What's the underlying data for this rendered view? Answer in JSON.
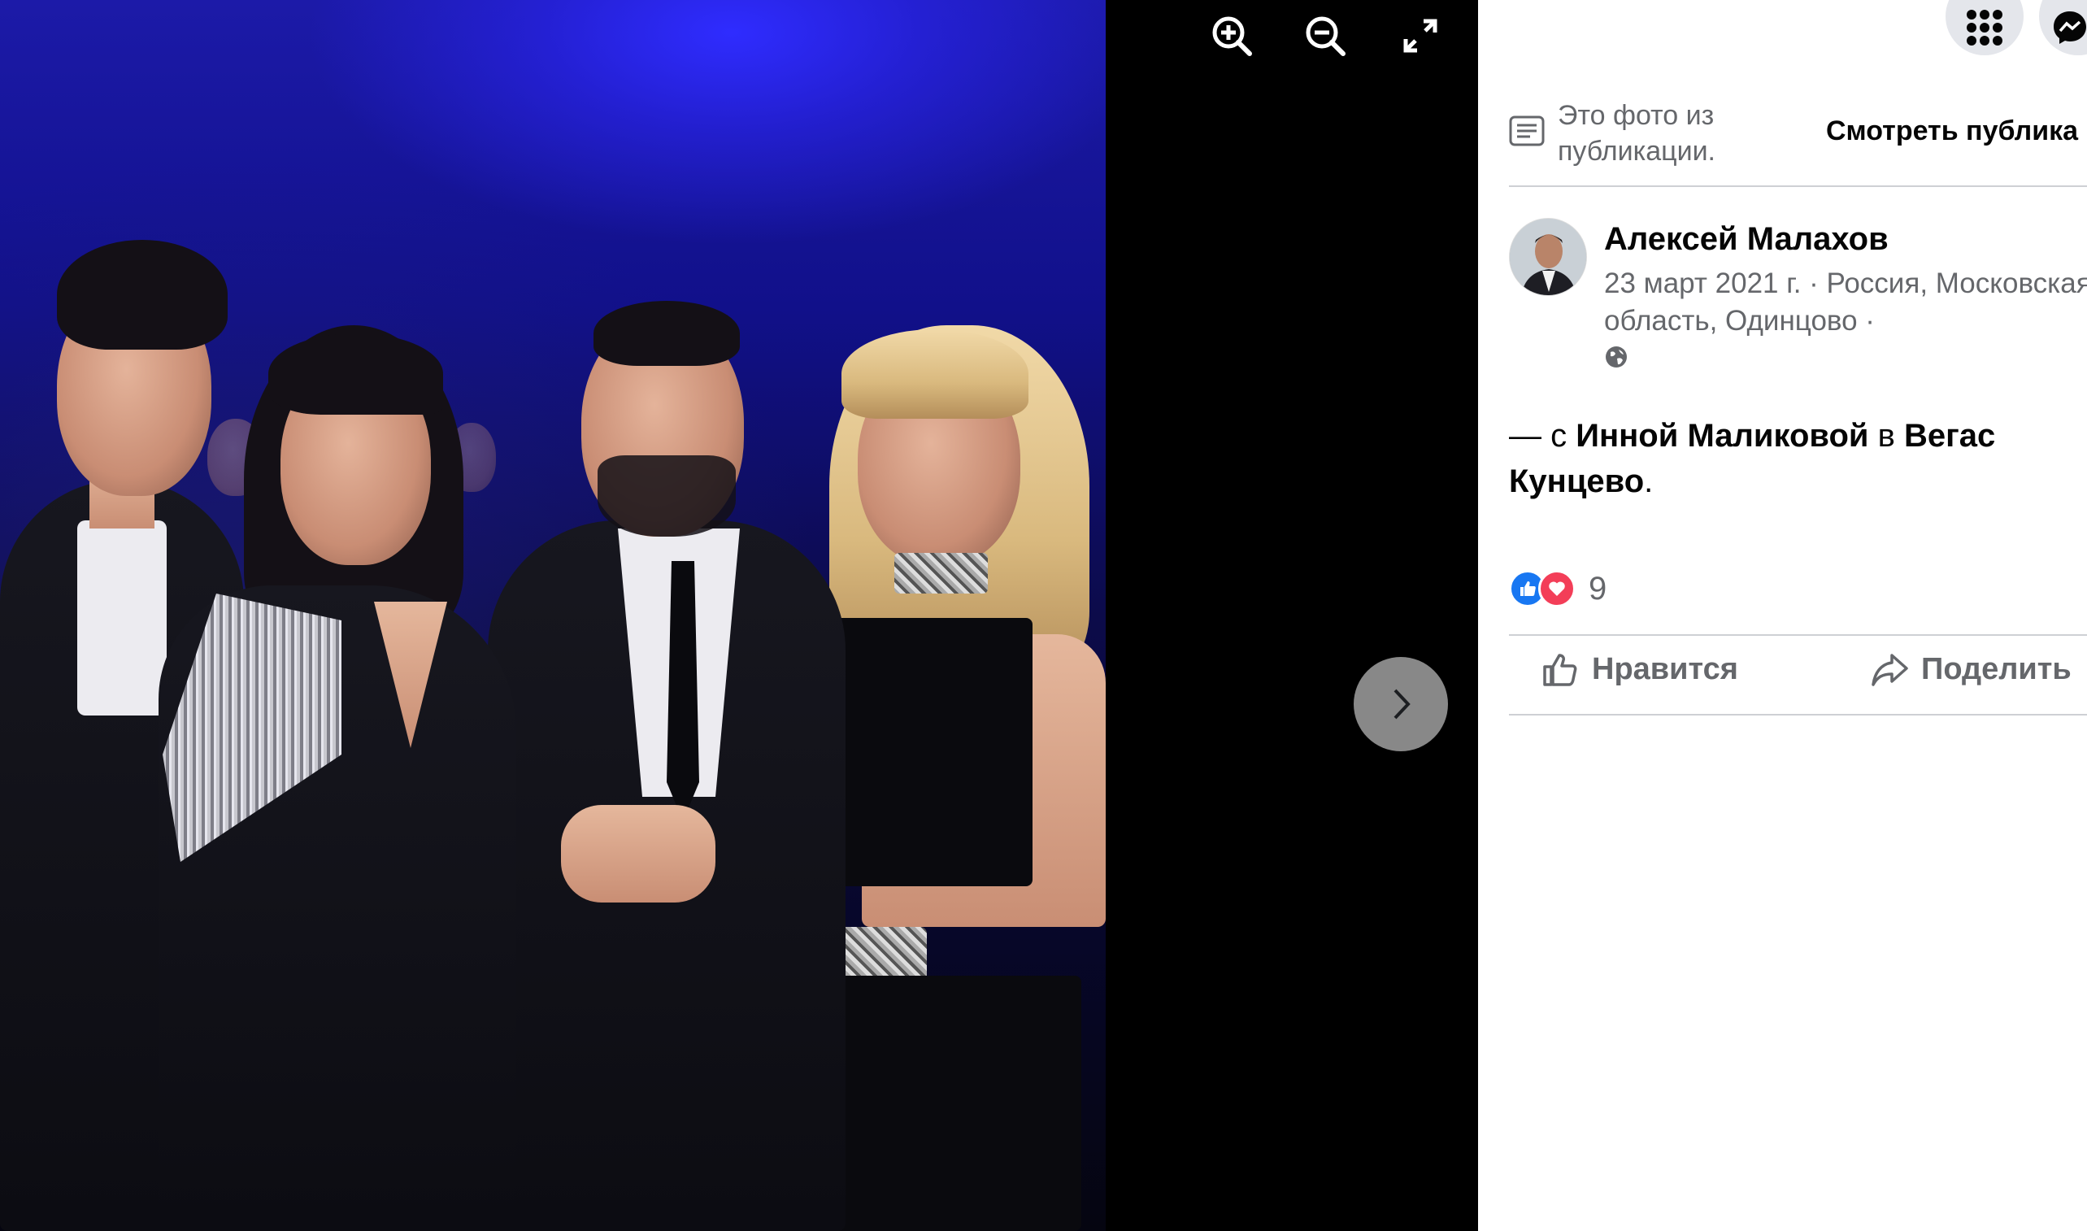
{
  "viewer": {
    "zoom_in_icon": "zoom-in-icon",
    "zoom_out_icon": "zoom-out-icon",
    "fullscreen_icon": "expand-icon",
    "next_icon": "chevron-right-icon"
  },
  "panel": {
    "top_icons": [
      "menu-grid-icon",
      "messenger-icon"
    ],
    "notice_text": "Это фото из публикации.",
    "view_post_label": "Смотреть публика",
    "author_name": "Алексей Малахов",
    "post_meta": "23 март 2021 г. · Россия, Московская область, Одинцово ·",
    "privacy_icon": "globe-icon",
    "caption": {
      "prefix": "— с ",
      "person": "Инной Маликовой",
      "middle": " в ",
      "place": "Вегас Кунцево",
      "suffix": "."
    },
    "reactions": {
      "types": [
        "like",
        "love"
      ],
      "count": "9"
    },
    "actions": {
      "like_label": "Нравится",
      "share_label": "Поделить"
    }
  },
  "colors": {
    "like_blue": "#1877f2",
    "love_red": "#f33e58",
    "secondary_text": "#65676b",
    "primary_text": "#050505"
  }
}
